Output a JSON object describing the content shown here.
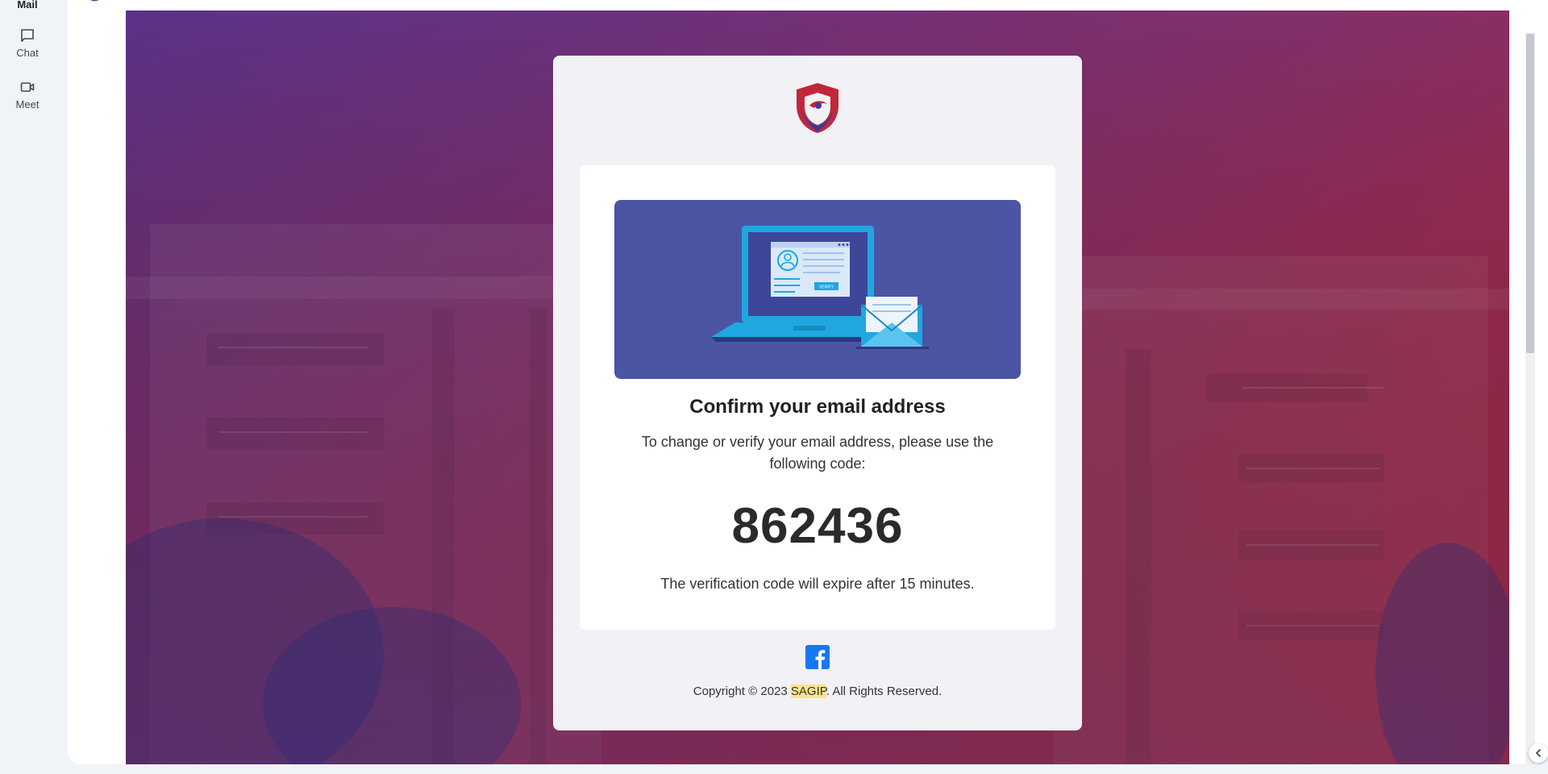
{
  "rail": {
    "mail_label": "Mail",
    "chat_label": "Chat",
    "meet_label": "Meet"
  },
  "email": {
    "heading": "Confirm your email address",
    "description": "To change or verify your email address, please use the following code:",
    "code": "862436",
    "expiry_note": "The verification code will expire after 15 minutes.",
    "illustration_button_text": "VERIFY",
    "social_icon": "facebook-icon",
    "copyright_prefix": "Copyright © 2023 ",
    "copyright_brand": "SAGIP",
    "copyright_suffix": ". All Rights Reserved."
  },
  "colors": {
    "gradient_start": "#5a3288",
    "gradient_end": "#c2282f",
    "card_background": "#f1f1f6",
    "illustration_background": "#4b55a4",
    "facebook_blue": "#1877f2",
    "highlight": "#fce48a"
  }
}
